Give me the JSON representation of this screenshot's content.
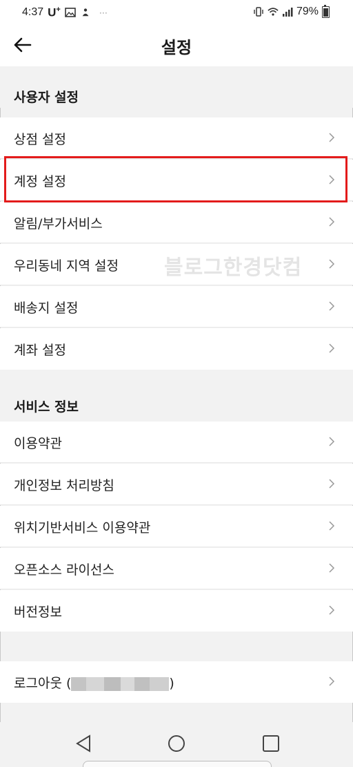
{
  "status_bar": {
    "time": "4:37",
    "carrier": "U",
    "carrier_sup": "+",
    "more": "···",
    "battery": "79%"
  },
  "header": {
    "title": "설정"
  },
  "sections": [
    {
      "title": "사용자 설정",
      "items": [
        {
          "label": "상점 설정"
        },
        {
          "label": "계정 설정"
        },
        {
          "label": "알림/부가서비스"
        },
        {
          "label": "우리동네 지역 설정"
        },
        {
          "label": "배송지 설정"
        },
        {
          "label": "계좌 설정"
        }
      ]
    },
    {
      "title": "서비스 정보",
      "items": [
        {
          "label": "이용약관"
        },
        {
          "label": "개인정보 처리방침"
        },
        {
          "label": "위치기반서비스 이용약관"
        },
        {
          "label": "오픈소스 라이선스"
        },
        {
          "label": "버전정보"
        }
      ]
    }
  ],
  "logout": {
    "label_prefix": "로그아웃 (",
    "label_suffix": ")"
  },
  "watermark": "블로그한경닷컴",
  "highlight_color": "#e31b1b"
}
